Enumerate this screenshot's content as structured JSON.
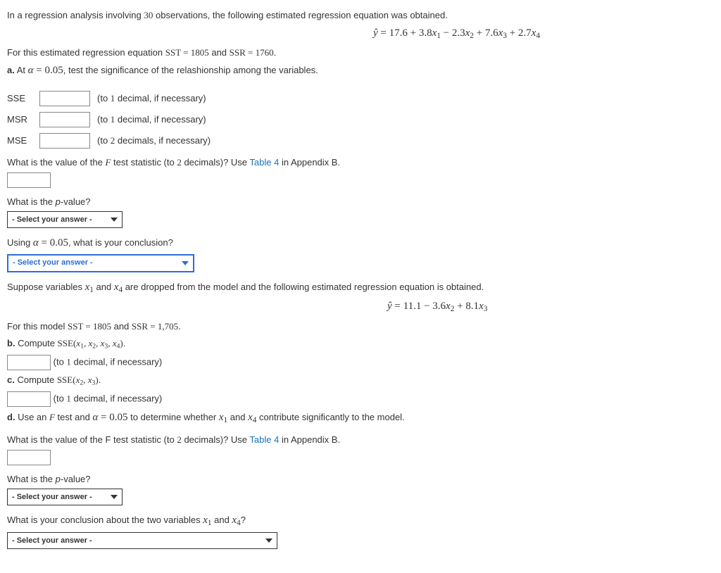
{
  "intro1_a": "In a regression analysis involving ",
  "intro1_n": "30",
  "intro1_b": " observations, the following estimated regression equation was obtained.",
  "eq1": "ŷ = 17.6 + 3.8x₁ − 2.3x₂ + 7.6x₃ + 2.7x₄",
  "sst_line_a": "For this estimated regression equation ",
  "sst_label": "SST = 1805",
  "sst_and": " and ",
  "ssr_label": "SSR = 1760",
  "sst_line_end": ".",
  "part_a_prefix": "a.",
  "part_a_at": " At ",
  "alpha_expr": "α = 0.05",
  "part_a_rest": ", test the significance of the relashionship among the variables.",
  "rows": {
    "sse": "SSE",
    "msr": "MSR",
    "mse": "MSE"
  },
  "hints": {
    "d1": "(to 1 decimal, if necessary)",
    "d2": "(to 2 decimals, if necessary)"
  },
  "f_question_a": "What is the value of the ",
  "f_letter": "F",
  "f_question_b": " test statistic (to ",
  "two": "2",
  "f_question_c": " decimals)? Use ",
  "table4": "Table 4",
  "appendix": " in Appendix B.",
  "pvalue_q": "What is the ",
  "p_word": "p",
  "pvalue_q2": "-value?",
  "select_placeholder": "- Select your answer -",
  "using_alpha_a": "Using ",
  "using_alpha_b": ", what is your conclusion?",
  "suppose_a": "Suppose variables ",
  "x1": "x₁",
  "and_word": " and ",
  "x4": "x₄",
  "suppose_b": " are dropped from the model and the following estimated regression equation is obtained.",
  "eq2": "ŷ = 11.1 − 3.6x₂ + 8.1x₃",
  "model2_a": "For this model ",
  "model2_sst": "SST = 1805",
  "model2_and": " and ",
  "model2_ssr": "SSR = 1,705",
  "model2_end": ".",
  "part_b_prefix": "b.",
  "part_b_text_a": " Compute ",
  "sse_full": "SSE(x₁, x₂, x₃, x₄)",
  "period": ".",
  "part_c_prefix": "c.",
  "sse_23": "SSE(x₂, x₃)",
  "part_d_prefix": "d.",
  "part_d_a": " Use an ",
  "part_d_b": " test and ",
  "part_d_c": " to determine whether ",
  "part_d_d": " contribute significantly to the model.",
  "f_q2": "What is the value of the F test statistic (to ",
  "f_q2b": " decimals)? Use ",
  "conclusion_q_a": "What is your conclusion about the two variables ",
  "conclusion_q_b": "?"
}
